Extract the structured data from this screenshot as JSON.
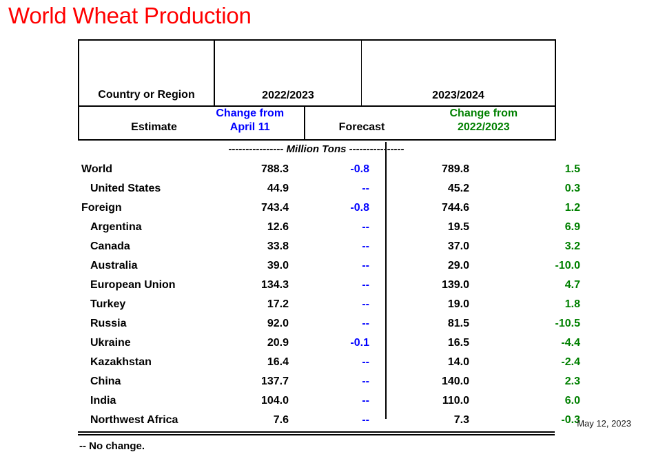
{
  "title": "World Wheat Production",
  "colors": {
    "title": "#FF0000",
    "change_prev_season": "#0000FF",
    "change_year_over_year": "#008000",
    "text": "#000000"
  },
  "table": {
    "stub_header": "Country or Region",
    "groups": [
      {
        "label": "2022/2023"
      },
      {
        "label": "2023/2024"
      }
    ],
    "columns": [
      {
        "key": "estimate",
        "label": "Estimate",
        "sublabel": "",
        "color": "#000000"
      },
      {
        "key": "change_april",
        "label": "April 11",
        "sublabel": "Change from",
        "color": "#0000FF"
      },
      {
        "key": "forecast",
        "label": "Forecast",
        "sublabel": "",
        "color": "#000000"
      },
      {
        "key": "change_season",
        "label": "2022/2023",
        "sublabel": "Change from",
        "color": "#008000"
      }
    ],
    "units_caption": "---------------- Million Tons ----------------",
    "rows": [
      {
        "name": "World",
        "indent": false,
        "estimate": "788.3",
        "change_april": "-0.8",
        "forecast": "789.8",
        "change_season": "1.5"
      },
      {
        "name": "United States",
        "indent": true,
        "estimate": "44.9",
        "change_april": "--",
        "forecast": "45.2",
        "change_season": "0.3"
      },
      {
        "name": "Foreign",
        "indent": false,
        "estimate": "743.4",
        "change_april": "-0.8",
        "forecast": "744.6",
        "change_season": "1.2"
      },
      {
        "name": "Argentina",
        "indent": true,
        "estimate": "12.6",
        "change_april": "--",
        "forecast": "19.5",
        "change_season": "6.9"
      },
      {
        "name": "Canada",
        "indent": true,
        "estimate": "33.8",
        "change_april": "--",
        "forecast": "37.0",
        "change_season": "3.2"
      },
      {
        "name": "Australia",
        "indent": true,
        "estimate": "39.0",
        "change_april": "--",
        "forecast": "29.0",
        "change_season": "-10.0"
      },
      {
        "name": "European Union",
        "indent": true,
        "estimate": "134.3",
        "change_april": "--",
        "forecast": "139.0",
        "change_season": "4.7"
      },
      {
        "name": "Turkey",
        "indent": true,
        "estimate": "17.2",
        "change_april": "--",
        "forecast": "19.0",
        "change_season": "1.8"
      },
      {
        "name": "Russia",
        "indent": true,
        "estimate": "92.0",
        "change_april": "--",
        "forecast": "81.5",
        "change_season": "-10.5"
      },
      {
        "name": "Ukraine",
        "indent": true,
        "estimate": "20.9",
        "change_april": "-0.1",
        "forecast": "16.5",
        "change_season": "-4.4"
      },
      {
        "name": "Kazakhstan",
        "indent": true,
        "estimate": "16.4",
        "change_april": "--",
        "forecast": "14.0",
        "change_season": "-2.4"
      },
      {
        "name": "China",
        "indent": true,
        "estimate": "137.7",
        "change_april": "--",
        "forecast": "140.0",
        "change_season": "2.3"
      },
      {
        "name": "India",
        "indent": true,
        "estimate": "104.0",
        "change_april": "--",
        "forecast": "110.0",
        "change_season": "6.0"
      },
      {
        "name": "Northwest Africa",
        "indent": true,
        "estimate": "7.6",
        "change_april": "--",
        "forecast": "7.3",
        "change_season": "-0.3"
      }
    ]
  },
  "footnote": "-- No change.",
  "date": "May 12, 2023",
  "chart_data": {
    "type": "table",
    "title": "World Wheat Production",
    "units": "Million Tons",
    "categories": [
      "World",
      "United States",
      "Foreign",
      "Argentina",
      "Canada",
      "Australia",
      "European Union",
      "Turkey",
      "Russia",
      "Ukraine",
      "Kazakhstan",
      "China",
      "India",
      "Northwest Africa"
    ],
    "series": [
      {
        "name": "2022/2023 Estimate",
        "values": [
          788.3,
          44.9,
          743.4,
          12.6,
          33.8,
          39.0,
          134.3,
          17.2,
          92.0,
          20.9,
          16.4,
          137.7,
          104.0,
          7.6
        ]
      },
      {
        "name": "2022/2023 Change from April 11",
        "values": [
          -0.8,
          null,
          -0.8,
          null,
          null,
          null,
          null,
          null,
          null,
          -0.1,
          null,
          null,
          null,
          null
        ]
      },
      {
        "name": "2023/2024 Forecast",
        "values": [
          789.8,
          45.2,
          744.6,
          19.5,
          37.0,
          29.0,
          139.0,
          19.0,
          81.5,
          16.5,
          14.0,
          140.0,
          110.0,
          7.3
        ]
      },
      {
        "name": "2023/2024 Change from 2022/2023",
        "values": [
          1.5,
          0.3,
          1.2,
          6.9,
          3.2,
          -10.0,
          4.7,
          1.8,
          -10.5,
          -4.4,
          -2.4,
          2.3,
          6.0,
          -0.3
        ]
      }
    ],
    "xlabel": "Country or Region",
    "ylabel": "Million Tons"
  }
}
